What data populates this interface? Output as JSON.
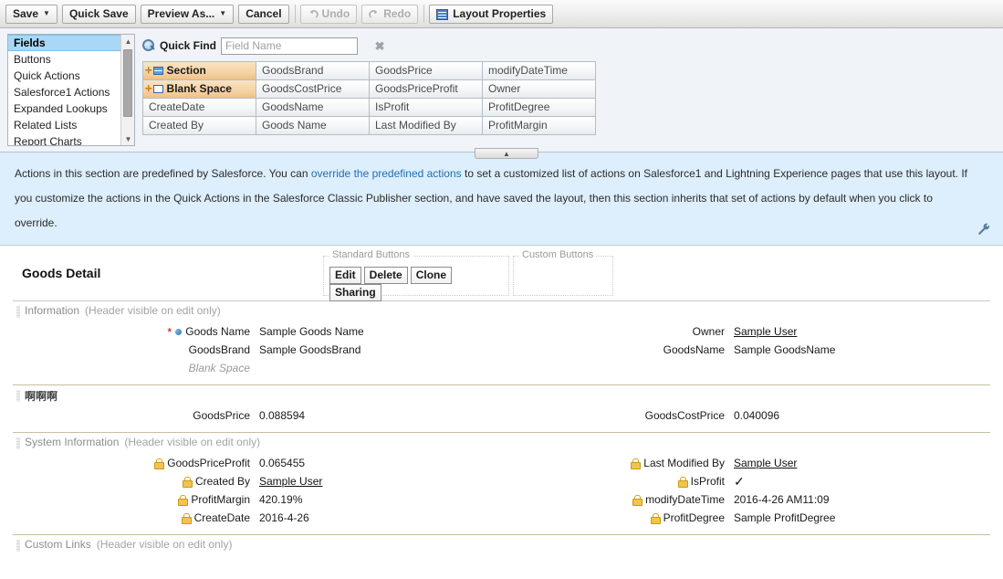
{
  "toolbar": {
    "buttons": [
      {
        "label": "Save",
        "caret": true,
        "disabled": false
      },
      {
        "label": "Quick Save",
        "caret": false,
        "disabled": false
      },
      {
        "label": "Preview As...",
        "caret": true,
        "disabled": false
      },
      {
        "label": "Cancel",
        "caret": false,
        "disabled": false
      }
    ],
    "undo_label": "Undo",
    "redo_label": "Redo",
    "layout_properties_label": "Layout Properties"
  },
  "palette": {
    "categories": [
      {
        "label": "Fields",
        "selected": true
      },
      {
        "label": "Buttons",
        "selected": false
      },
      {
        "label": "Quick Actions",
        "selected": false
      },
      {
        "label": "Salesforce1 Actions",
        "selected": false
      },
      {
        "label": "Expanded Lookups",
        "selected": false
      },
      {
        "label": "Related Lists",
        "selected": false
      },
      {
        "label": "Report Charts",
        "selected": false
      }
    ],
    "quick_find_label": "Quick Find",
    "quick_find_placeholder": "Field Name",
    "quick_find_value": "",
    "fields": [
      {
        "label": "Section",
        "type": "section"
      },
      {
        "label": "GoodsBrand",
        "type": "field"
      },
      {
        "label": "GoodsPrice",
        "type": "field"
      },
      {
        "label": "modifyDateTime",
        "type": "field"
      },
      {
        "label": "Blank Space",
        "type": "blank"
      },
      {
        "label": "GoodsCostPrice",
        "type": "field"
      },
      {
        "label": "GoodsPriceProfit",
        "type": "field"
      },
      {
        "label": "Owner",
        "type": "field"
      },
      {
        "label": "CreateDate",
        "type": "field"
      },
      {
        "label": "GoodsName",
        "type": "field"
      },
      {
        "label": "IsProfit",
        "type": "field"
      },
      {
        "label": "ProfitDegree",
        "type": "field"
      },
      {
        "label": "Created By",
        "type": "field"
      },
      {
        "label": "Goods Name",
        "type": "field"
      },
      {
        "label": "Last Modified By",
        "type": "field"
      },
      {
        "label": "ProfitMargin",
        "type": "field"
      }
    ]
  },
  "banner": {
    "text_before_link": "Actions in this section are predefined by Salesforce. You can ",
    "link_text": "override the predefined actions",
    "text_after_link": " to set a customized list of actions on Salesforce1 and Lightning Experience pages that use this layout. If you customize the actions in the Quick Actions in the Salesforce Classic Publisher section, and have saved the layout, then this section inherits that set of actions by default when you click to override."
  },
  "detail": {
    "title": "Goods Detail",
    "standard_buttons_label": "Standard Buttons",
    "custom_buttons_label": "Custom Buttons",
    "standard_buttons": [
      "Edit",
      "Delete",
      "Clone",
      "Sharing"
    ]
  },
  "sections": [
    {
      "title": "Information",
      "note": "(Header visible on edit only)",
      "dark_title": false,
      "rows": [
        {
          "left": {
            "label": "Goods Name",
            "value": "Sample Goods Name",
            "required": true,
            "dot": true,
            "lock": false,
            "link": false
          },
          "right": {
            "label": "Owner",
            "value": "Sample User",
            "required": false,
            "dot": false,
            "lock": false,
            "link": true
          }
        },
        {
          "left": {
            "label": "GoodsBrand",
            "value": "Sample GoodsBrand",
            "required": false,
            "dot": false,
            "lock": false,
            "link": false
          },
          "right": {
            "label": "GoodsName",
            "value": "Sample GoodsName",
            "required": false,
            "dot": false,
            "lock": false,
            "link": false
          }
        }
      ],
      "blank_space_label": "Blank Space",
      "has_blank_space": true
    },
    {
      "title": "啊啊啊",
      "note": "",
      "dark_title": true,
      "rows": [
        {
          "left": {
            "label": "GoodsPrice",
            "value": "0.088594",
            "required": false,
            "dot": false,
            "lock": false,
            "link": false
          },
          "right": {
            "label": "GoodsCostPrice",
            "value": "0.040096",
            "required": false,
            "dot": false,
            "lock": false,
            "link": false
          }
        }
      ],
      "has_blank_space": false
    },
    {
      "title": "System Information",
      "note": "(Header visible on edit only)",
      "dark_title": false,
      "rows": [
        {
          "left": {
            "label": "GoodsPriceProfit",
            "value": "0.065455",
            "required": false,
            "dot": false,
            "lock": true,
            "link": false
          },
          "right": {
            "label": "Last Modified By",
            "value": "Sample User",
            "required": false,
            "dot": false,
            "lock": true,
            "link": true
          }
        },
        {
          "left": {
            "label": "Created By",
            "value": "Sample User",
            "required": false,
            "dot": false,
            "lock": true,
            "link": true
          },
          "right": {
            "label": "IsProfit",
            "value": "✓",
            "required": false,
            "dot": false,
            "lock": true,
            "link": false,
            "check": true
          }
        },
        {
          "left": {
            "label": "ProfitMargin",
            "value": "420.19%",
            "required": false,
            "dot": false,
            "lock": true,
            "link": false
          },
          "right": {
            "label": "modifyDateTime",
            "value": "2016-4-26 AM11:09",
            "required": false,
            "dot": false,
            "lock": true,
            "link": false
          }
        },
        {
          "left": {
            "label": "CreateDate",
            "value": "2016-4-26",
            "required": false,
            "dot": false,
            "lock": true,
            "link": false
          },
          "right": {
            "label": "ProfitDegree",
            "value": "Sample ProfitDegree",
            "required": false,
            "dot": false,
            "lock": true,
            "link": false
          }
        }
      ],
      "has_blank_space": false
    },
    {
      "title": "Custom Links",
      "note": "(Header visible on edit only)",
      "dark_title": false,
      "rows": [],
      "has_blank_space": false
    }
  ],
  "colors": {
    "banner_bg": "#ddeefc",
    "link": "#1f6fb4",
    "selection": "#a8d8f5",
    "special_field": "#f5d3a4",
    "section_divider": "#c8bf9c",
    "lock": "#f2c44d",
    "required": "#c90000"
  }
}
